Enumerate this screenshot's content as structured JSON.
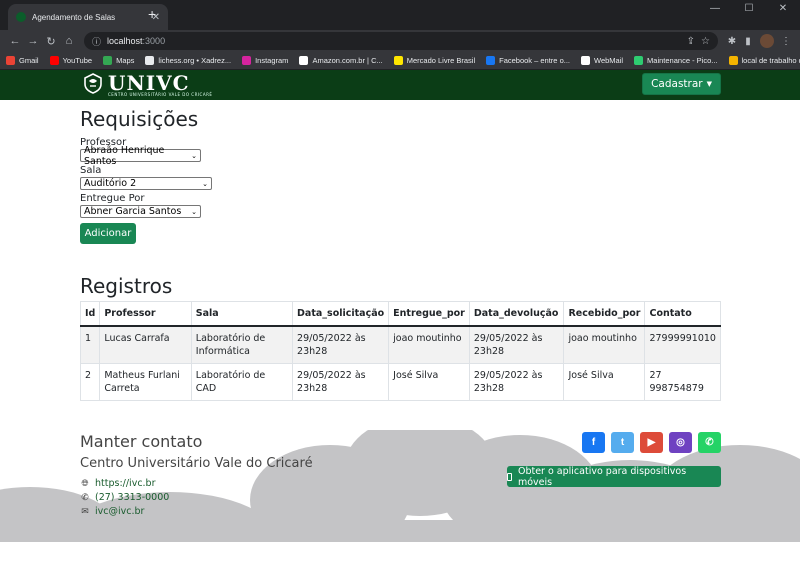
{
  "browser": {
    "tab_title": "Agendamento de Salas",
    "url_host": "localhost",
    "url_port": ":3000",
    "bookmarks": [
      {
        "label": "Gmail",
        "color": "#ea4335"
      },
      {
        "label": "YouTube",
        "color": "#ff0000"
      },
      {
        "label": "Maps",
        "color": "#34a853"
      },
      {
        "label": "lichess.org • Xadrez...",
        "color": "#e8eaed"
      },
      {
        "label": "Instagram",
        "color": "#d6249f"
      },
      {
        "label": "Amazon.com.br | C...",
        "color": "#ffffff"
      },
      {
        "label": "Mercado Livre Brasil",
        "color": "#ffe600"
      },
      {
        "label": "Facebook – entre o...",
        "color": "#1877f2"
      },
      {
        "label": "WebMail",
        "color": "#ffffff"
      },
      {
        "label": "Maintenance - Pico...",
        "color": "#2ecc71"
      },
      {
        "label": "local de trabalho d...",
        "color": "#f4b400"
      }
    ]
  },
  "navbar": {
    "brand": "UNIVC",
    "brand_sub": "CENTRO UNIVERSITÁRIO VALE DO CRICARÉ",
    "menu_label": "Cadastrar"
  },
  "form": {
    "title": "Requisições",
    "professor_label": "Professor",
    "professor_value": "Abraão Henrique Santos",
    "sala_label": "Sala",
    "sala_value": "Auditório 2",
    "entregue_label": "Entregue Por",
    "entregue_value": "Abner Garcia Santos",
    "submit_label": "Adicionar"
  },
  "records": {
    "title": "Registros",
    "columns": [
      "Id",
      "Professor",
      "Sala",
      "Data_solicitação",
      "Entregue_por",
      "Data_devolução",
      "Recebido_por",
      "Contato"
    ],
    "rows": [
      [
        "1",
        "Lucas Carrafa",
        "Laboratório de Informática",
        "29/05/2022 às 23h28",
        "joao moutinho",
        "29/05/2022 às 23h28",
        "joao moutinho",
        "27999991010"
      ],
      [
        "2",
        "Matheus Furlani Carreta",
        "Laboratório de CAD",
        "29/05/2022 às 23h28",
        "José Silva",
        "29/05/2022 às 23h28",
        "José Silva",
        "27 998754879"
      ]
    ]
  },
  "footer": {
    "title": "Manter contato",
    "subtitle": "Centro Universitário Vale do Cricaré",
    "website": "https://ivc.br",
    "phone": "(27) 3313-0000",
    "email": "ivc@ivc.br",
    "app_button": "Obter o aplicativo para dispositivos móveis",
    "socials": [
      {
        "name": "facebook",
        "glyph": "f",
        "color": "#1877f2"
      },
      {
        "name": "twitter",
        "glyph": "t",
        "color": "#55acee"
      },
      {
        "name": "youtube",
        "glyph": "▶",
        "color": "#dd4b39"
      },
      {
        "name": "instagram",
        "glyph": "◎",
        "color": "#6f42c1"
      },
      {
        "name": "whatsapp",
        "glyph": "✆",
        "color": "#25d366"
      }
    ]
  }
}
